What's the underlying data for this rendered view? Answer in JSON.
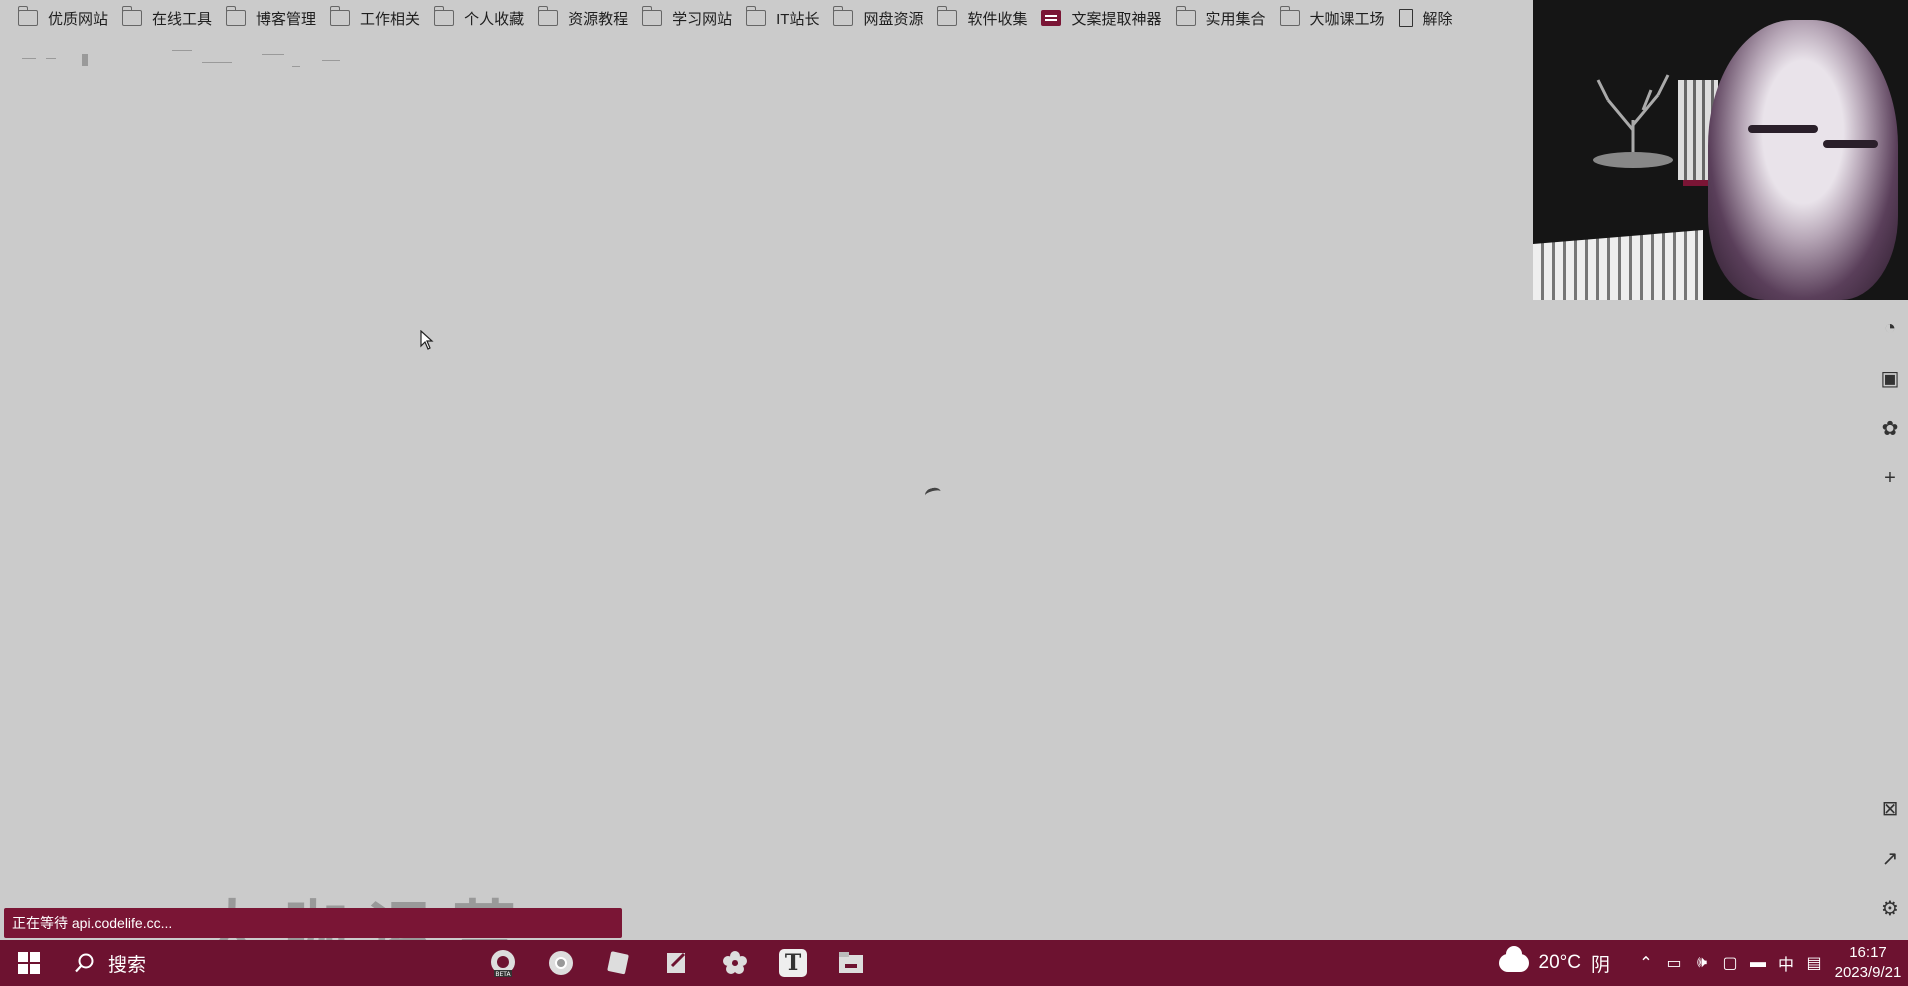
{
  "bookmarks": [
    {
      "label": "优质网站",
      "icon": "folder-icon"
    },
    {
      "label": "在线工具",
      "icon": "folder-icon"
    },
    {
      "label": "博客管理",
      "icon": "folder-icon"
    },
    {
      "label": "工作相关",
      "icon": "folder-icon"
    },
    {
      "label": "个人收藏",
      "icon": "folder-icon"
    },
    {
      "label": "资源教程",
      "icon": "folder-icon"
    },
    {
      "label": "学习网站",
      "icon": "folder-icon"
    },
    {
      "label": "IT站长",
      "icon": "folder-icon"
    },
    {
      "label": "网盘资源",
      "icon": "folder-icon"
    },
    {
      "label": "软件收集",
      "icon": "folder-icon"
    },
    {
      "label": "文案提取神器",
      "icon": "app-icon"
    },
    {
      "label": "实用集合",
      "icon": "folder-icon"
    },
    {
      "label": "大咖课工场",
      "icon": "folder-icon"
    },
    {
      "label": "解除",
      "icon": "page-icon"
    }
  ],
  "status": {
    "loading_text": "正在等待 api.codelife.cc..."
  },
  "watermark": "大咖运营",
  "right_sidebar": [
    {
      "name": "refresh-circle-icon",
      "glyph": "◔"
    },
    {
      "name": "game-icon",
      "glyph": "▣"
    },
    {
      "name": "extension-icon",
      "glyph": "✿"
    },
    {
      "name": "add-icon",
      "glyph": "+"
    },
    {
      "name": "screenshot-icon",
      "glyph": "⊠"
    },
    {
      "name": "external-link-icon",
      "glyph": "↗"
    },
    {
      "name": "settings-icon",
      "glyph": "⚙"
    }
  ],
  "taskbar": {
    "search_label": "搜索",
    "apps": [
      "edge-beta-icon",
      "chrome-icon",
      "notes-icon",
      "editor-icon",
      "flower-app-icon",
      "typora-icon",
      "file-explorer-icon"
    ],
    "typora_letter": "T",
    "beta_badge": "BETA",
    "weather_temp": "20°C",
    "weather_desc": "阴",
    "ime": "中",
    "time": "16:17",
    "date": "2023/9/21"
  },
  "colors": {
    "accent": "#6d1230",
    "background": "#cbcbcb"
  }
}
